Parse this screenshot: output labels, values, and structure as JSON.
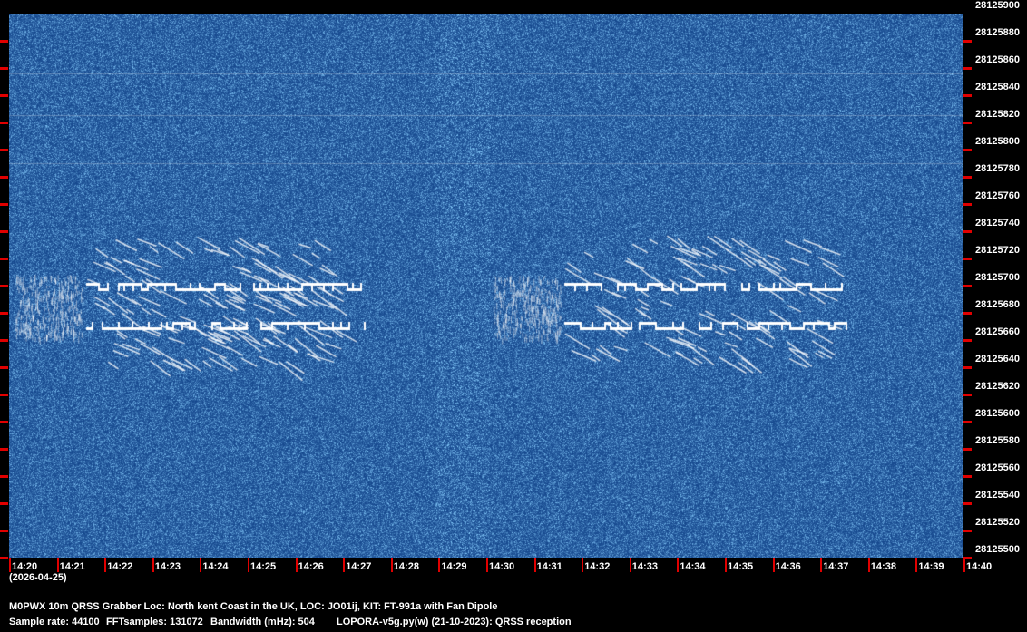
{
  "frequency_labels": [
    "28125900",
    "28125880",
    "28125860",
    "28125840",
    "28125820",
    "28125800",
    "28125780",
    "28125760",
    "28125740",
    "28125720",
    "28125700",
    "28125680",
    "28125660",
    "28125640",
    "28125620",
    "28125600",
    "28125580",
    "28125560",
    "28125540",
    "28125520",
    "28125500"
  ],
  "time_labels": [
    "14:20",
    "14:21",
    "14:22",
    "14:23",
    "14:24",
    "14:25",
    "14:26",
    "14:27",
    "14:28",
    "14:29",
    "14:30",
    "14:31",
    "14:32",
    "14:33",
    "14:34",
    "14:35",
    "14:36",
    "14:37",
    "14:38",
    "14:39",
    "14:40"
  ],
  "date": "(2026-04-25)",
  "station_line": "M0PWX 10m QRSS Grabber Loc: North kent Coast in the UK, LOC: JO01ij, KIT: FT-991a with Fan Dipole",
  "params": {
    "sample_rate": "Sample rate: 44100",
    "fft_samples": "FFTsamples: 131072",
    "bandwidth": "Bandwidth (mHz): 504",
    "software": "LOPORA-v5g.py(w) (21-10-2023): QRSS reception"
  },
  "colors": {
    "background": "#000000",
    "waterfall": "#1f5a9e",
    "tick": "#e00000",
    "signal": "#ffffff"
  }
}
